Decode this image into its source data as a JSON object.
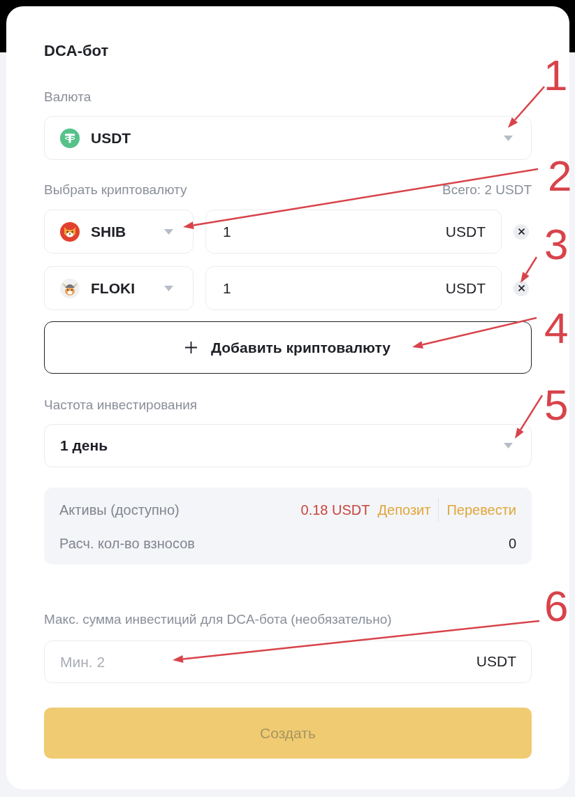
{
  "dialog": {
    "title": "DCA-бот"
  },
  "currency": {
    "label": "Валюта",
    "value": "USDT"
  },
  "crypto": {
    "label": "Выбрать криптовалюту",
    "total": "Всего: 2 USDT",
    "rows": [
      {
        "coin": "SHIB",
        "amount": "1",
        "unit": "USDT"
      },
      {
        "coin": "FLOKI",
        "amount": "1",
        "unit": "USDT"
      }
    ],
    "add_button": {
      "label": "Добавить криптовалюту"
    }
  },
  "frequency": {
    "label": "Частота инвестирования",
    "value": "1 день"
  },
  "summary": {
    "rows": [
      {
        "kind": "balance",
        "label": "Активы (доступно)",
        "value": "0.18 USDT",
        "links": [
          "Депозит",
          "Перевести"
        ]
      },
      {
        "kind": "plain",
        "label": "Расч. кол-во взносов",
        "value": "0"
      }
    ]
  },
  "max_amount": {
    "label": "Макс. сумма инвестиций для DCA-бота (необязательно)",
    "placeholder": "Мин. 2",
    "unit": "USDT"
  },
  "create_button": {
    "label": "Создать",
    "disabled": true
  },
  "annotations": [
    {
      "label": "1"
    },
    {
      "label": "2"
    },
    {
      "label": "3"
    },
    {
      "label": "4"
    },
    {
      "label": "5"
    },
    {
      "label": "6"
    }
  ]
}
